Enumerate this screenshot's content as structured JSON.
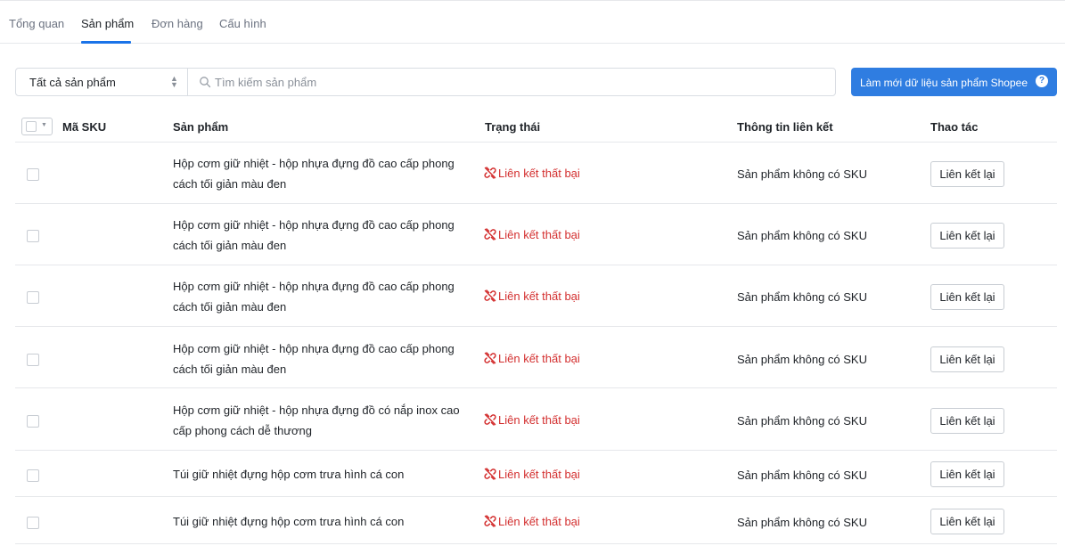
{
  "tabs": [
    {
      "label": "Tổng quan",
      "active": false
    },
    {
      "label": "Sản phẩm",
      "active": true
    },
    {
      "label": "Đơn hàng",
      "active": false
    },
    {
      "label": "Cấu hình",
      "active": false
    }
  ],
  "filter": {
    "select_value": "Tất cả sản phẩm",
    "search_placeholder": "Tìm kiếm sản phẩm"
  },
  "refresh_button": {
    "label": "Làm mới dữ liệu sản phẩm Shopee",
    "help_glyph": "?"
  },
  "table": {
    "headers": {
      "sku": "Mã SKU",
      "product": "Sản phẩm",
      "status": "Trạng thái",
      "link_info": "Thông tin liên kết",
      "actions": "Thao tác"
    },
    "rows": [
      {
        "product": "Hộp cơm giữ nhiệt - hộp nhựa đựng đồ cao cấp phong cách tối giản màu đen",
        "status": "Liên kết thất bại",
        "link_info": "Sản phẩm không có SKU",
        "action": "Liên kết lại"
      },
      {
        "product": "Hộp cơm giữ nhiệt - hộp nhựa đựng đồ cao cấp phong cách tối giản màu đen",
        "status": "Liên kết thất bại",
        "link_info": "Sản phẩm không có SKU",
        "action": "Liên kết lại"
      },
      {
        "product": "Hộp cơm giữ nhiệt - hộp nhựa đựng đồ cao cấp phong cách tối giản màu đen",
        "status": "Liên kết thất bại",
        "link_info": "Sản phẩm không có SKU",
        "action": "Liên kết lại"
      },
      {
        "product": "Hộp cơm giữ nhiệt - hộp nhựa đựng đồ cao cấp phong cách tối giản màu đen",
        "status": "Liên kết thất bại",
        "link_info": "Sản phẩm không có SKU",
        "action": "Liên kết lại"
      },
      {
        "product": "Hộp cơm giữ nhiệt - hộp nhựa đựng đồ có nắp inox cao cấp phong cách dễ thương",
        "status": "Liên kết thất bại",
        "link_info": "Sản phẩm không có SKU",
        "action": "Liên kết lại"
      },
      {
        "product": "Túi giữ nhiệt đựng hộp cơm trưa hình cá con",
        "status": "Liên kết thất bại",
        "link_info": "Sản phẩm không có SKU",
        "action": "Liên kết lại"
      },
      {
        "product": "Túi giữ nhiệt đựng hộp cơm trưa hình cá con",
        "status": "Liên kết thất bại",
        "link_info": "Sản phẩm không có SKU",
        "action": "Liên kết lại"
      }
    ]
  },
  "colors": {
    "accent": "#2f7de1",
    "tab_underline": "#1a73e8",
    "error": "#d32f2f",
    "border": "#e6e8eb"
  },
  "icons": {
    "search": "search-icon",
    "status": "broken-link-icon",
    "help": "help-circle-icon",
    "select_caret": "chevron-updown-icon",
    "bulk_caret": "chevron-down-icon"
  }
}
